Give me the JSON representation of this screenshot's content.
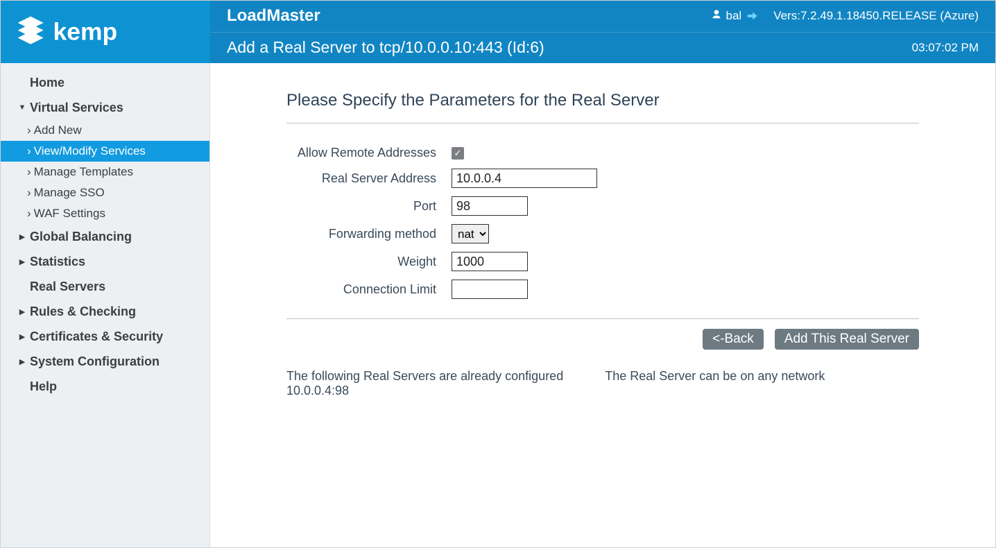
{
  "header": {
    "app_title": "LoadMaster",
    "user": "bal",
    "version": "Vers:7.2.49.1.18450.RELEASE (Azure)",
    "subtitle": "Add a Real Server to tcp/10.0.0.10:443 (Id:6)",
    "clock": "03:07:02 PM"
  },
  "sidebar": {
    "items": [
      {
        "label": "Home",
        "type": "plain"
      },
      {
        "label": "Virtual Services",
        "type": "expanded",
        "children": [
          {
            "label": "Add New"
          },
          {
            "label": "View/Modify Services",
            "active": true
          },
          {
            "label": "Manage Templates"
          },
          {
            "label": "Manage SSO"
          },
          {
            "label": "WAF Settings"
          }
        ]
      },
      {
        "label": "Global Balancing",
        "type": "collapsed"
      },
      {
        "label": "Statistics",
        "type": "collapsed"
      },
      {
        "label": "Real Servers",
        "type": "plain"
      },
      {
        "label": "Rules & Checking",
        "type": "collapsed"
      },
      {
        "label": "Certificates & Security",
        "type": "collapsed"
      },
      {
        "label": "System Configuration",
        "type": "collapsed"
      },
      {
        "label": "Help",
        "type": "plain"
      }
    ]
  },
  "form": {
    "title": "Please Specify the Parameters for the Real Server",
    "labels": {
      "allow_remote": "Allow Remote Addresses",
      "address": "Real Server Address",
      "port": "Port",
      "forwarding": "Forwarding method",
      "weight": "Weight",
      "conn_limit": "Connection Limit"
    },
    "values": {
      "allow_remote_checked": true,
      "address": "10.0.0.4",
      "port": "98",
      "forwarding": "nat",
      "weight": "1000",
      "conn_limit": ""
    },
    "buttons": {
      "back": "<-Back",
      "add": "Add This Real Server"
    }
  },
  "notes": {
    "configured_intro": "The following Real Servers are already configured",
    "configured_list": "10.0.0.4:98",
    "any_network": "The Real Server can be on any network"
  }
}
